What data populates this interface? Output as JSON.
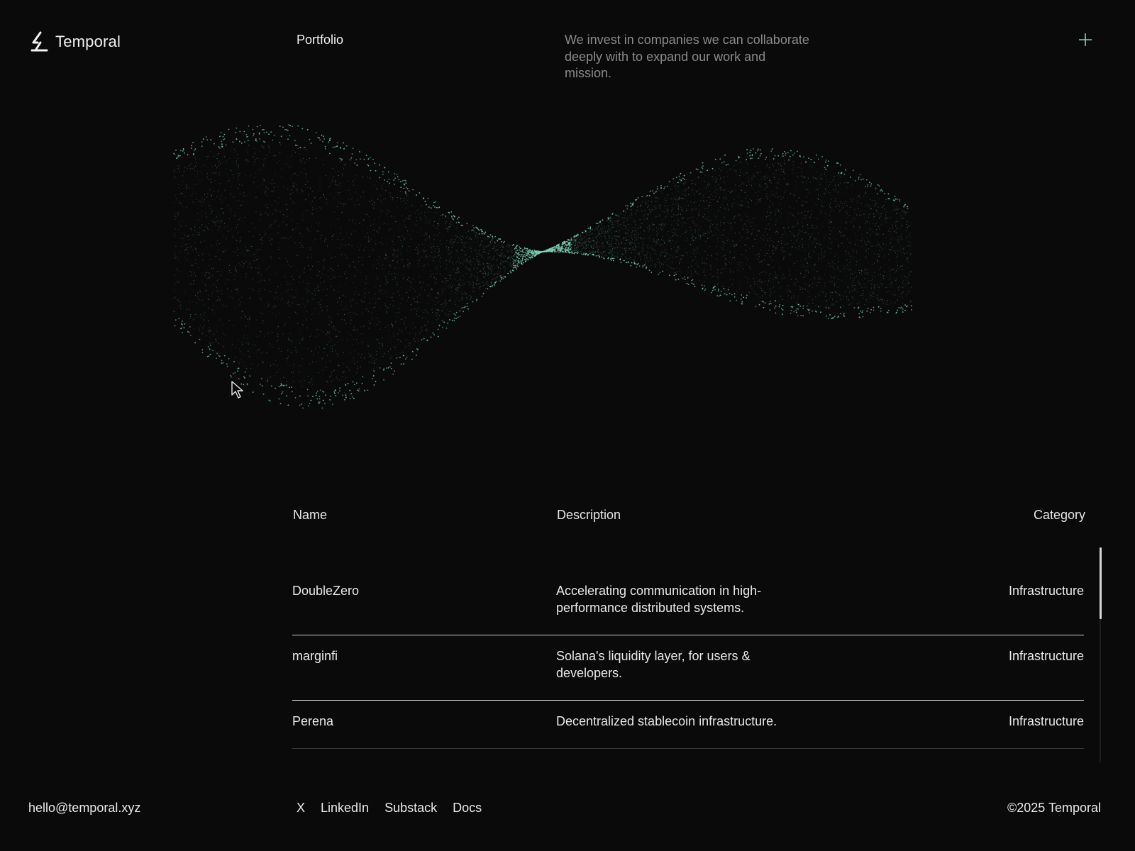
{
  "brand": {
    "name": "Temporal",
    "logo_icon": "temporal-logo-icon"
  },
  "nav": {
    "portfolio_label": "Portfolio"
  },
  "tagline": "We invest in companies we can collaborate deeply with to expand our work and mission.",
  "header_action": {
    "icon": "plus-icon",
    "color": "#7fd4b8"
  },
  "visual": {
    "accent_color": "#7fd4b8"
  },
  "table": {
    "headers": {
      "name": "Name",
      "description": "Description",
      "category": "Category"
    },
    "rows": [
      {
        "name": "DoubleZero",
        "description": "Accelerating communication in high-performance distributed systems.",
        "category": "Infrastructure"
      },
      {
        "name": "marginfi",
        "description": "Solana's liquidity layer, for users & developers.",
        "category": "Infrastructure"
      },
      {
        "name": "Perena",
        "description": "Decentralized stablecoin infrastructure.",
        "category": "Infrastructure"
      }
    ]
  },
  "footer": {
    "email": "hello@temporal.xyz",
    "socials": [
      "X",
      "LinkedIn",
      "Substack",
      "Docs"
    ],
    "copyright": "©2025 Temporal"
  }
}
